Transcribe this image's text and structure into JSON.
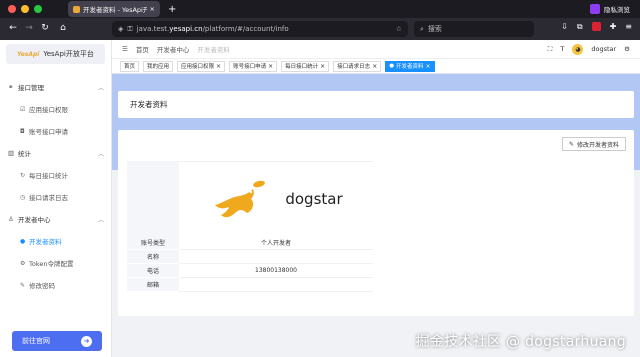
{
  "browser": {
    "tab_title": "开发者资料 - YesApi开放平台",
    "new_tab": "+",
    "private_label": "隐私浏览",
    "url_prefix": "java.test.",
    "url_domain": "yesapi.cn",
    "url_path": "/platform/#/account/info",
    "search_placeholder": "搜索"
  },
  "sidebar": {
    "logo_mark": "YesApi",
    "logo_text": "YesApi开放平台",
    "groups": [
      {
        "label": "接口管理",
        "items": [
          "应用接口权限",
          "账号接口申请"
        ]
      },
      {
        "label": "统计",
        "items": [
          "每日接口统计",
          "接口请求日志"
        ]
      },
      {
        "label": "开发者中心",
        "items": [
          "开发者资料",
          "Token令牌配置",
          "修改密码"
        ]
      }
    ],
    "go_button": "前往官网"
  },
  "topbar": {
    "breadcrumb": [
      "首页",
      "开发者中心",
      "开发者资料"
    ],
    "username": "dogstar"
  },
  "tags": [
    "首页",
    "我的应用",
    "应用接口权限",
    "账号接口申请",
    "每日接口统计",
    "接口请求日志",
    "开发者资料"
  ],
  "page": {
    "title": "开发者资料",
    "edit_button": "修改开发者资料",
    "logo_name": "dogstar",
    "fields": [
      {
        "key": "账号类型",
        "value": "个人开发者"
      },
      {
        "key": "名称",
        "value": ""
      },
      {
        "key": "电话",
        "value": "13800138000"
      },
      {
        "key": "邮箱",
        "value": ""
      }
    ]
  },
  "watermark": "掘金技术社区 @ dogstarhuang",
  "colors": {
    "accent": "#1890ff",
    "band": "#b3c7f5",
    "go_button": "#4e6ef2",
    "logo_orange": "#f0a81c"
  }
}
